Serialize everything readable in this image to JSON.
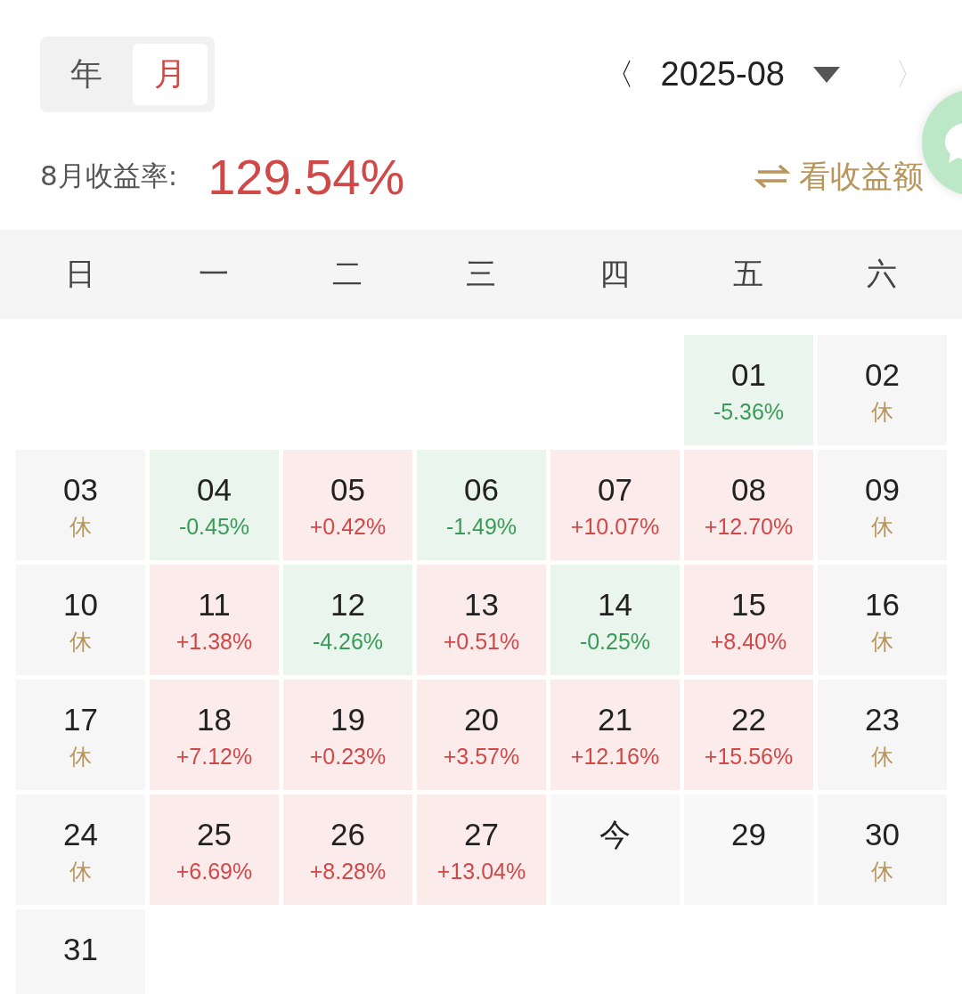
{
  "view_toggle": [
    {
      "label": "年",
      "selected": false
    },
    {
      "label": "月",
      "selected": true
    }
  ],
  "month_nav": {
    "prev": "〈",
    "month": "2025-08",
    "next": "〉",
    "next_disabled": true
  },
  "summary": {
    "label": "8月收益率:",
    "value": "129.54%",
    "switch_label": "看收益额"
  },
  "weekdays": [
    "日",
    "一",
    "二",
    "三",
    "四",
    "五",
    "六"
  ],
  "weeks": [
    [
      {
        "kind": "empty"
      },
      {
        "kind": "empty"
      },
      {
        "kind": "empty"
      },
      {
        "kind": "empty"
      },
      {
        "kind": "empty"
      },
      {
        "kind": "loss",
        "date": "01",
        "note": "-5.36%"
      },
      {
        "kind": "rest",
        "date": "02",
        "note": "休"
      }
    ],
    [
      {
        "kind": "rest",
        "date": "03",
        "note": "休"
      },
      {
        "kind": "loss",
        "date": "04",
        "note": "-0.45%"
      },
      {
        "kind": "gain",
        "date": "05",
        "note": "+0.42%"
      },
      {
        "kind": "loss",
        "date": "06",
        "note": "-1.49%"
      },
      {
        "kind": "gain",
        "date": "07",
        "note": "+10.07%"
      },
      {
        "kind": "gain",
        "date": "08",
        "note": "+12.70%"
      },
      {
        "kind": "rest",
        "date": "09",
        "note": "休"
      }
    ],
    [
      {
        "kind": "rest",
        "date": "10",
        "note": "休"
      },
      {
        "kind": "gain",
        "date": "11",
        "note": "+1.38%"
      },
      {
        "kind": "loss",
        "date": "12",
        "note": "-4.26%"
      },
      {
        "kind": "gain",
        "date": "13",
        "note": "+0.51%"
      },
      {
        "kind": "loss",
        "date": "14",
        "note": "-0.25%"
      },
      {
        "kind": "gain",
        "date": "15",
        "note": "+8.40%"
      },
      {
        "kind": "rest",
        "date": "16",
        "note": "休"
      }
    ],
    [
      {
        "kind": "rest",
        "date": "17",
        "note": "休"
      },
      {
        "kind": "gain",
        "date": "18",
        "note": "+7.12%"
      },
      {
        "kind": "gain",
        "date": "19",
        "note": "+0.23%"
      },
      {
        "kind": "gain",
        "date": "20",
        "note": "+3.57%"
      },
      {
        "kind": "gain",
        "date": "21",
        "note": "+12.16%"
      },
      {
        "kind": "gain",
        "date": "22",
        "note": "+15.56%"
      },
      {
        "kind": "rest",
        "date": "23",
        "note": "休"
      }
    ],
    [
      {
        "kind": "rest",
        "date": "24",
        "note": "休"
      },
      {
        "kind": "gain",
        "date": "25",
        "note": "+6.69%"
      },
      {
        "kind": "gain",
        "date": "26",
        "note": "+8.28%"
      },
      {
        "kind": "gain",
        "date": "27",
        "note": "+13.04%"
      },
      {
        "kind": "today",
        "date": "今"
      },
      {
        "kind": "future",
        "date": "29"
      },
      {
        "kind": "rest",
        "date": "30",
        "note": "休"
      }
    ],
    [
      {
        "kind": "rest",
        "date": "31"
      }
    ]
  ]
}
